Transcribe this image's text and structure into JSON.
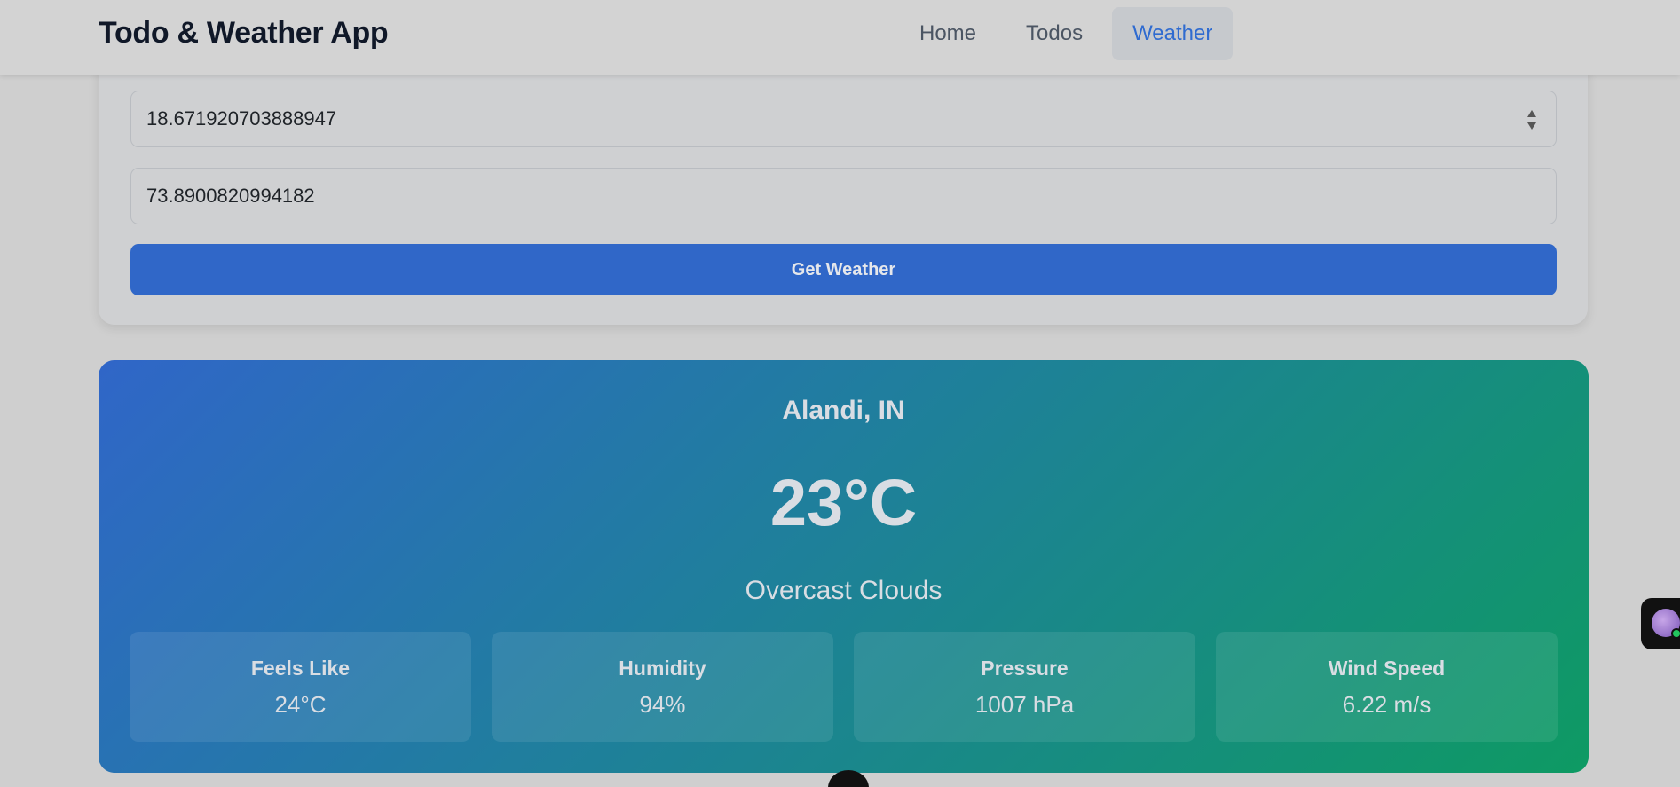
{
  "header": {
    "title": "Todo & Weather App",
    "nav": [
      {
        "label": "Home",
        "active": false
      },
      {
        "label": "Todos",
        "active": false
      },
      {
        "label": "Weather",
        "active": true
      }
    ]
  },
  "form": {
    "latitude_value": "18.671920703888947",
    "longitude_value": "73.8900820994182",
    "submit_label": "Get Weather"
  },
  "weather": {
    "location": "Alandi, IN",
    "temperature": "23°C",
    "description": "Overcast Clouds",
    "stats": [
      {
        "label": "Feels Like",
        "value": "24°C"
      },
      {
        "label": "Humidity",
        "value": "94%"
      },
      {
        "label": "Pressure",
        "value": "1007 hPa"
      },
      {
        "label": "Wind Speed",
        "value": "6.22 m/s"
      }
    ]
  },
  "colors": {
    "accent": "#3067c8",
    "gradient_start": "#3066c8",
    "gradient_end": "#0e9a63"
  }
}
